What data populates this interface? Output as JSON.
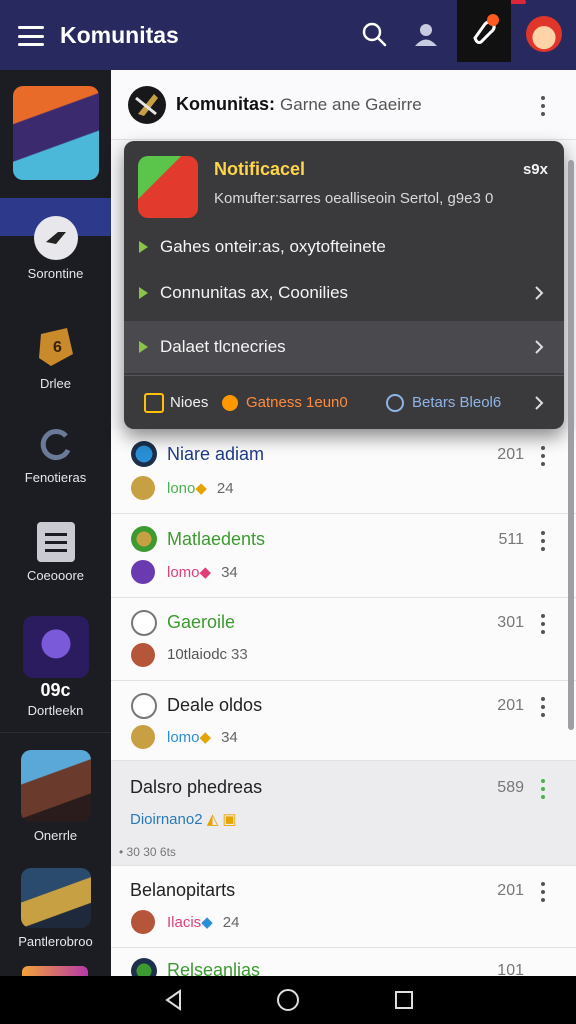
{
  "topbar": {
    "title": "Komunitas",
    "icons": [
      "menu-icon",
      "search-icon",
      "user-icon",
      "notification-icon",
      "profile-avatar"
    ],
    "bg_color": "#28295f"
  },
  "sidebar": {
    "items": [
      {
        "label": "",
        "icon": "game-thumb"
      },
      {
        "label": "Sorontine",
        "icon": "chat-bubble-icon"
      },
      {
        "label": "Drlee",
        "icon": "trophy-icon"
      },
      {
        "label": "Fenotieras",
        "icon": "refresh-icon"
      },
      {
        "label": "Coeooore",
        "icon": "list-icon"
      },
      {
        "label": "Dortleekn",
        "badge": "09c",
        "icon": "game-thumb"
      },
      {
        "label": "Onerrle",
        "icon": "game-thumb"
      },
      {
        "label": "Pantlerobroo",
        "icon": "game-thumb"
      }
    ]
  },
  "header": {
    "title": "Komunitas:",
    "subtitle": "Garne ane Gaeirre"
  },
  "popup": {
    "title": "Notificacel",
    "close_label": "s9x",
    "body": "Komufter:sarres oealliseoin Sertol, g9e3 0",
    "rows": [
      {
        "label": "Gahes onteir:as, oxytofteinete",
        "chevron": false
      },
      {
        "label": "Connunitas ax, Coonilies",
        "chevron": true
      },
      {
        "label": "Dalaet tlcnecries",
        "chevron": true
      }
    ],
    "footer": {
      "label1": "Nioes",
      "label2": "Gatness 1eun0",
      "label3": "Betars Bleol6"
    }
  },
  "list": [
    {
      "title": "Niare adiam",
      "title_color": "#1f3b87",
      "count": "201",
      "sub": "lono",
      "sub_num": "24",
      "sub_color": "#4caf50"
    },
    {
      "title": "Matlaedents",
      "title_color": "#3d9a30",
      "count": "511",
      "sub": "lomo",
      "sub_num": "34",
      "sub_color": "#e0407a"
    },
    {
      "title": "Gaeroile",
      "title_color": "#3d9a30",
      "count": "301",
      "sub": "10tlaiodc",
      "sub_num": "33",
      "sub_color": "#555555"
    },
    {
      "title": "Deale oldos",
      "title_color": "#222222",
      "count": "201",
      "sub": "lomo",
      "sub_num": "34",
      "sub_color": "#2a8fd6"
    },
    {
      "title": "Dalsro phedreas",
      "title_color": "#222222",
      "count": "589",
      "sub": "Dioirnano2",
      "sub_num": "",
      "sub_color": "#2a7ab8",
      "foot": "• 30 30 6ts",
      "highlight": true
    },
    {
      "title": "Belanopitarts",
      "title_color": "#222222",
      "count": "201",
      "sub": "Ilacis",
      "sub_num": "24",
      "sub_color": "#e0407a"
    },
    {
      "title": "Relseanlias",
      "title_color": "#222222",
      "count": "101",
      "sub": "",
      "sub_num": "",
      "sub_color": "#555555"
    }
  ],
  "colors": {
    "accent": "#2d3a8c",
    "popup_title": "#ffd54a",
    "popup_bg": "#3a3a3d"
  }
}
